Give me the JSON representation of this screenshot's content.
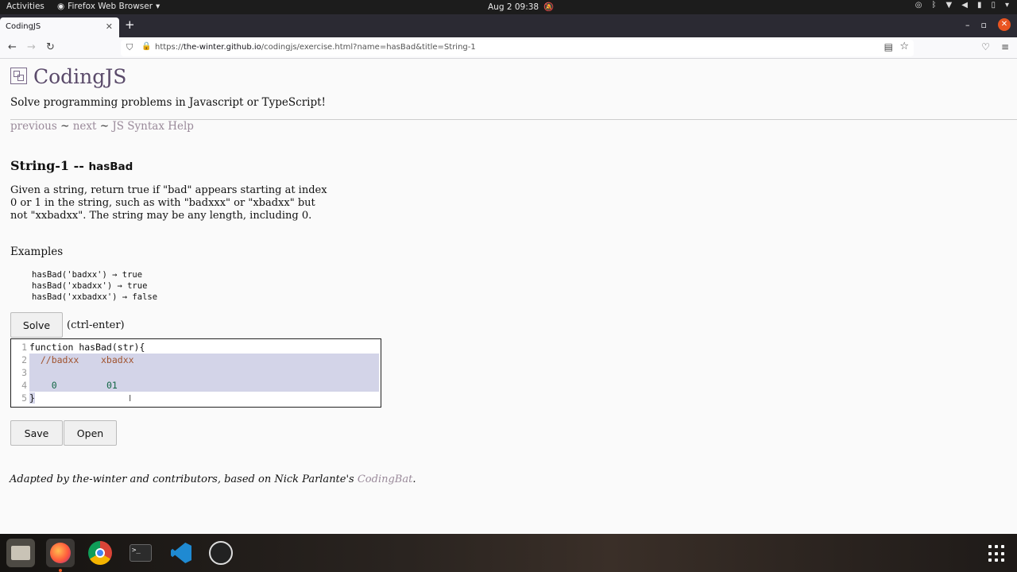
{
  "system": {
    "activities": "Activities",
    "app_menu": "Firefox Web Browser",
    "clock": "Aug 2  09:38"
  },
  "browser": {
    "tab_title": "CodingJS",
    "url_prefix": "https://",
    "url_host": "the-winter.github.io",
    "url_path": "/codingjs/exercise.html?name=hasBad&title=String-1"
  },
  "page": {
    "site_title": "CodingJS",
    "tagline": "Solve programming problems in Javascript or TypeScript!",
    "nav": {
      "previous": "previous",
      "sep1": " ~ ",
      "next": "next",
      "sep2": " ~ ",
      "help": "JS Syntax Help"
    },
    "problem_category": "String-1 -- ",
    "problem_name": "hasBad",
    "description": "Given a string, return true if \"bad\" appears starting at index 0 or 1 in the string, such as with \"badxxx\" or \"xbadxx\" but not \"xxbadxx\". The string may be any length, including 0.",
    "examples_label": "Examples",
    "examples": [
      "hasBad('badxx') → true",
      "hasBad('xbadxx') → true",
      "hasBad('xxbadxx') → false"
    ],
    "solve_button": "Solve",
    "solve_hint": "(ctrl-enter)",
    "editor": {
      "line_numbers": [
        "1",
        "2",
        "3",
        "4",
        "5"
      ],
      "line1_kw": "function",
      "line1_rest": " hasBad(str){",
      "line2": "  //badxx    xbadxx",
      "line4_a": "    0",
      "line4_b": "01",
      "line5": "}"
    },
    "save_button": "Save",
    "open_button": "Open",
    "footer_text": "Adapted by the-winter and contributors, based on Nick Parlante's ",
    "footer_link": "CodingBat",
    "footer_end": "."
  }
}
